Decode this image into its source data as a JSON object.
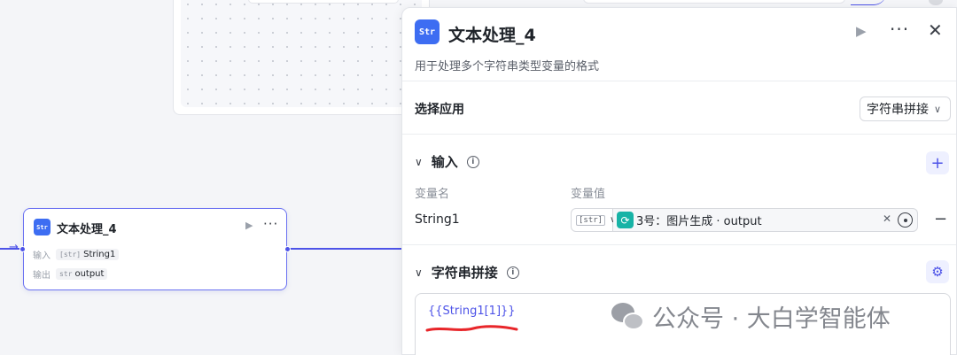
{
  "canvas_node": {
    "icon_text": "Str",
    "title": "文本处理_4",
    "run_symbol": "▶",
    "more_symbol": "···",
    "rows": [
      {
        "label": "输入",
        "type_badge": "[str]",
        "value": "String1"
      },
      {
        "label": "输出",
        "type_badge": "str",
        "value": "output"
      }
    ]
  },
  "panel": {
    "icon_text": "Str",
    "title": "文本处理_4",
    "run_symbol": "▶",
    "more_symbol": "···",
    "close_symbol": "✕",
    "description": "用于处理多个字符串类型变量的格式",
    "select_app": {
      "label": "选择应用",
      "value": "字符串拼接",
      "chevron": "∨"
    },
    "input_section": {
      "caret": "∨",
      "title": "输入",
      "info": "i",
      "add_symbol": "+",
      "col_name": "变量名",
      "col_value": "变量值",
      "rows": [
        {
          "name": "String1",
          "type_badge": "[str]",
          "type_chevron": "∨",
          "ref_icon": "⟳",
          "ref_text": "3号：图片生成 · output",
          "clear_symbol": "✕",
          "remove_symbol": "−"
        }
      ]
    },
    "concat_section": {
      "caret": "∨",
      "title": "字符串拼接",
      "info": "i",
      "settings_symbol": "⚙",
      "template": "{{String1[1]}}"
    }
  },
  "watermark": {
    "text": "公众号 · 大白学智能体"
  },
  "colors": {
    "accent": "#4d53e8",
    "node_icon": "#3d6df2",
    "ref_icon": "#17b3a6",
    "annotation_red": "#e8262a"
  }
}
